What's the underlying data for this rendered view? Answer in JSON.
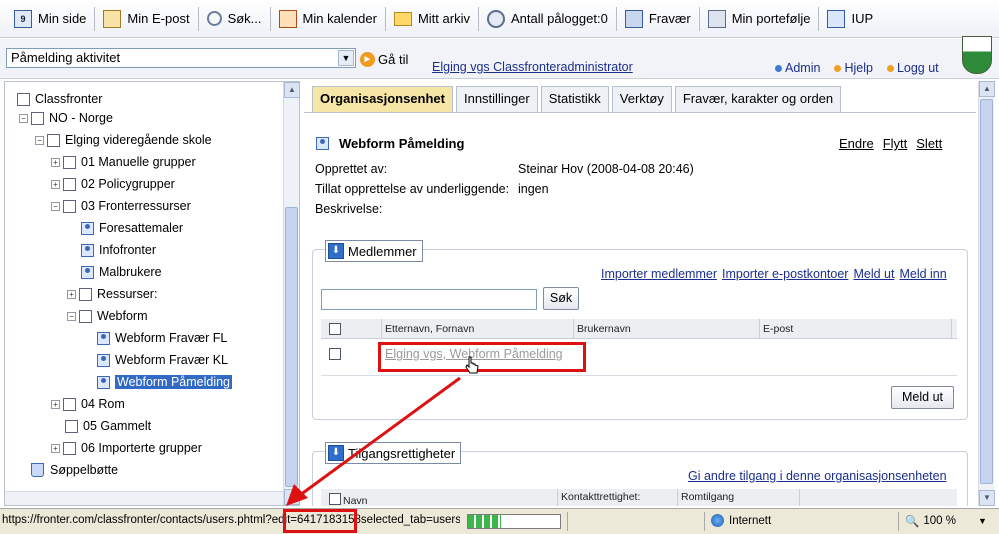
{
  "toolbar": {
    "items": [
      {
        "label": "Min side",
        "icon": "min-side-icon"
      },
      {
        "label": "Min E-post",
        "icon": "mail-icon"
      },
      {
        "label": "Søk...",
        "icon": "search-icon"
      },
      {
        "label": "Min kalender",
        "icon": "calendar-icon"
      },
      {
        "label": "Mitt arkiv",
        "icon": "folder-icon"
      },
      {
        "label": "Antall pålogget:0",
        "icon": "users-online-icon"
      },
      {
        "label": "Fravær",
        "icon": "absence-book-icon"
      },
      {
        "label": "Min portefølje",
        "icon": "portfolio-icon"
      },
      {
        "label": "IUP",
        "icon": "iup-icon"
      }
    ],
    "min_side_badge": "9"
  },
  "nav": {
    "select_value": "Påmelding aktivitet",
    "goto_label": "Gå til",
    "admin_link": "Elging vgs Classfronteradministrator",
    "links": [
      "Admin",
      "Hjelp",
      "Logg ut"
    ],
    "link_colors": [
      "#3b7bd8",
      "#f0a020",
      "#f0a020"
    ]
  },
  "tree": {
    "nodes": [
      {
        "label": "Classfronter"
      },
      {
        "label": "NO - Norge"
      },
      {
        "label": "Elging videregående skole"
      },
      {
        "label": "01 Manuelle grupper"
      },
      {
        "label": "02 Policygrupper"
      },
      {
        "label": "03 Fronterressurser"
      },
      {
        "label": "Foresattemaler"
      },
      {
        "label": "Infofronter"
      },
      {
        "label": "Malbrukere"
      },
      {
        "label": "Ressurser:"
      },
      {
        "label": "Webform"
      },
      {
        "label": "Webform Fravær FL"
      },
      {
        "label": "Webform Fravær KL"
      },
      {
        "label": "Webform Påmelding"
      },
      {
        "label": "04 Rom"
      },
      {
        "label": "05 Gammelt"
      },
      {
        "label": "06 Importerte grupper"
      },
      {
        "label": "Søppelbøtte"
      }
    ]
  },
  "tabs": [
    "Organisasjonsenhet",
    "Innstillinger",
    "Statistikk",
    "Verktøy",
    "Fravær, karakter og orden"
  ],
  "object": {
    "title": "Webform Påmelding",
    "actions": [
      "Endre",
      "Flytt",
      "Slett"
    ],
    "created_by_label": "Opprettet av:",
    "created_by_value": "Steinar Hov (2008-04-08 20:46)",
    "allow_label": "Tillat opprettelse av underliggende:",
    "allow_value": "ingen",
    "desc_label": "Beskrivelse:"
  },
  "members": {
    "legend": "Medlemmer",
    "links": [
      "Importer medlemmer",
      "Importer e-postkontoer",
      "Meld ut",
      "Meld inn"
    ],
    "search_value": "",
    "search_button": "Søk",
    "columns": [
      "Etternavn, Fornavn",
      "Brukernavn",
      "E-post"
    ],
    "rows": [
      {
        "name": "Elging vgs, Webform Påmelding"
      }
    ],
    "leave_button": "Meld ut"
  },
  "access": {
    "legend": "Tilgangsrettigheter",
    "link": "Gi andre tilgang i denne organisasjonsenheten",
    "columns": [
      "Navn",
      "Kontakttrettighet:",
      "Romtilgang"
    ]
  },
  "status": {
    "url": "https://fronter.com/classfronter/contacts/users.phtml?edit=6417183158selected_tab=users_cc",
    "zone": "Internett",
    "zoom": "100 %"
  },
  "colors": {
    "highlight": "#dd1111",
    "active_tab": "#f6e6a6",
    "link": "#1b2f8c"
  }
}
